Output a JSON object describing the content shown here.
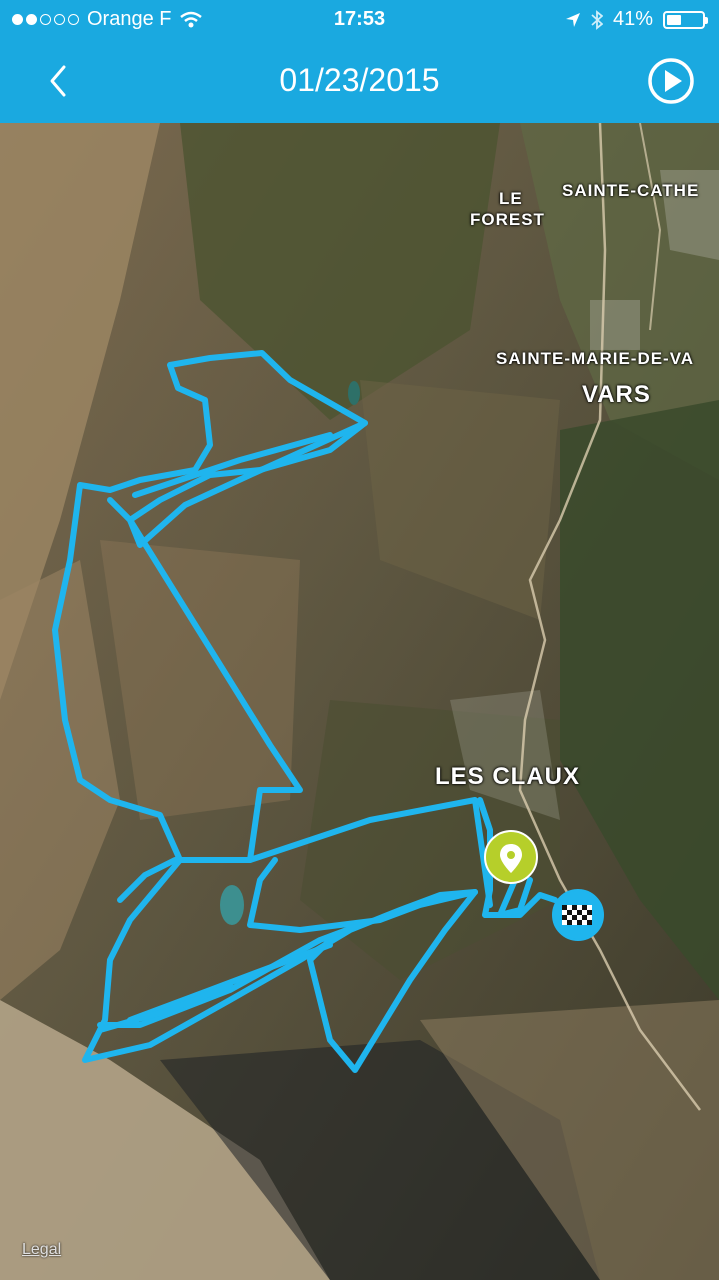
{
  "status": {
    "carrier": "Orange F",
    "time": "17:53",
    "battery": "41%",
    "battery_level": 0.41,
    "signal_bars": 2
  },
  "header": {
    "title": "01/23/2015",
    "back_icon": "chevron-left-icon",
    "play_icon": "play-circle-icon"
  },
  "map": {
    "type": "satellite",
    "labels": {
      "le": "LE",
      "forest": "FOREST",
      "sainte_catherine": "SAINTE-CATHE",
      "sainte_marie": "SAINTE-MARIE-DE-VA",
      "vars": "VARS",
      "les_claux": "LES CLAUX"
    },
    "start_marker_icon": "location-pin-icon",
    "finish_marker_icon": "checkered-flag-icon",
    "track_color": "#1fb5ee",
    "start_color": "#b6cf2a",
    "legal": "Legal"
  }
}
